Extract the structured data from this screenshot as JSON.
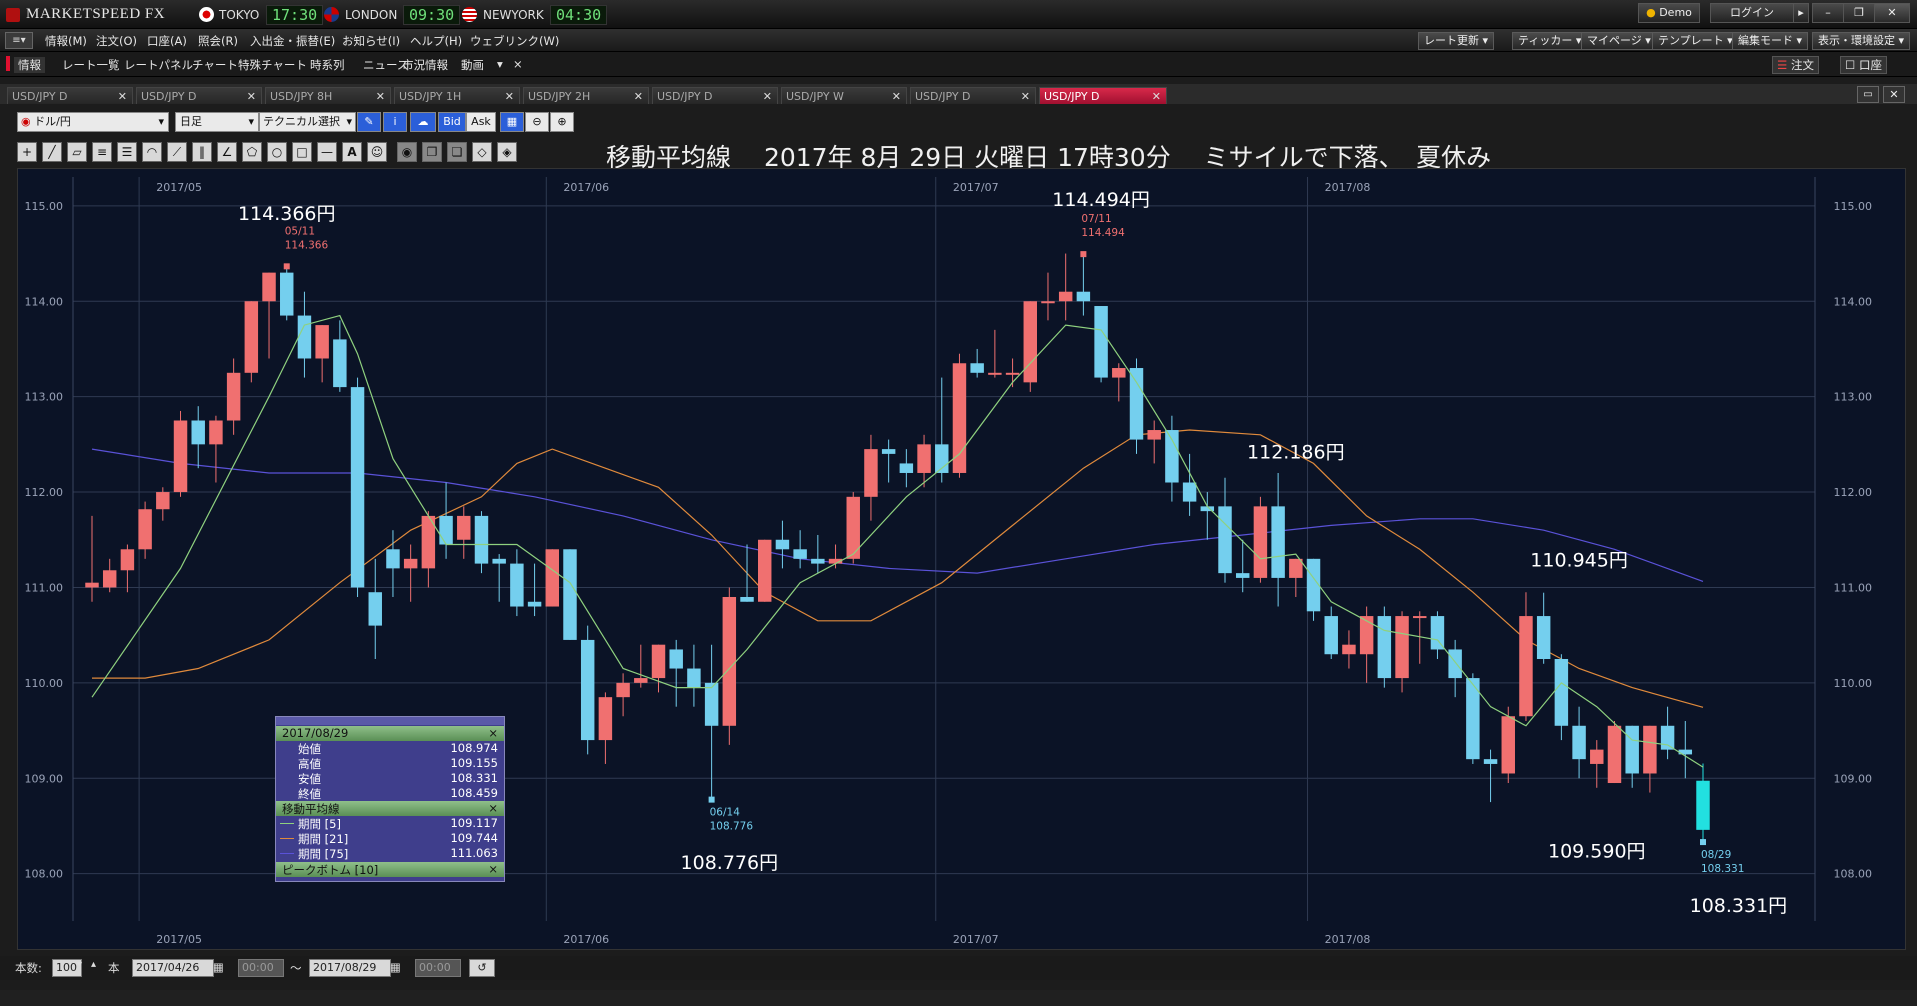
{
  "app": {
    "title": "MARKETSPEED FX",
    "clocks": [
      {
        "city": "TOKYO",
        "time": "17:30"
      },
      {
        "city": "LONDON",
        "time": "09:30"
      },
      {
        "city": "NEWYORK",
        "time": "04:30"
      }
    ],
    "demo_label": "Demo",
    "login_label": "ログイン",
    "window_controls": [
      "minimize",
      "restore",
      "close"
    ]
  },
  "menu": {
    "items": [
      "情報(M)",
      "注文(O)",
      "口座(A)",
      "照会(R)",
      "入出金・振替(E)",
      "お知らせ(I)",
      "ヘルプ(H)",
      "ウェブリンク(W)"
    ],
    "right_buttons": [
      "レート更新",
      "ティッカー",
      "マイページ",
      "テンプレート",
      "編集モード",
      "表示・環境設定"
    ]
  },
  "subtoolbar": {
    "info_label": "情報",
    "items": [
      "レート一覧",
      "レートパネル",
      "チャート",
      "特殊チャート",
      "時系列",
      "ニュース",
      "市況情報",
      "動画"
    ],
    "order_label": "注文",
    "account_label": "口座"
  },
  "tabs": [
    "USD/JPY D",
    "USD/JPY D",
    "USD/JPY 8H",
    "USD/JPY 1H",
    "USD/JPY 2H",
    "USD/JPY D",
    "USD/JPY W",
    "USD/JPY D",
    "USD/JPY D"
  ],
  "active_tab": 8,
  "chart_controls": {
    "pair": "ドル/円",
    "period": "日足",
    "technical": "テクニカル選択",
    "bid": "Bid",
    "ask": "Ask"
  },
  "chart_title": "移動平均線　 2017年 8月 29日 火曜日 17時30分　 ミサイルで下落、　夏休み",
  "status": {
    "count_label": "本数:",
    "count_value": "100",
    "count_unit": "本",
    "from_date": "2017/04/26",
    "from_time": "00:00",
    "tilde": "〜",
    "to_date": "2017/08/29",
    "to_time": "00:00"
  },
  "infobox": {
    "date": "2017/08/29",
    "ohlc": [
      {
        "label": "始値",
        "value": "108.974"
      },
      {
        "label": "高値",
        "value": "109.155"
      },
      {
        "label": "安値",
        "value": "108.331"
      },
      {
        "label": "終値",
        "value": "108.459"
      }
    ],
    "ma_header": "移動平均線",
    "ma": [
      {
        "label": "期間 [5]",
        "value": "109.117",
        "color": "#8fd17f"
      },
      {
        "label": "期間 [21]",
        "value": "109.744",
        "color": "#e08a3c"
      },
      {
        "label": "期間 [75]",
        "value": "111.063",
        "color": "#5a52d8"
      }
    ],
    "peak_header": "ピークボトム [10]"
  },
  "chart_data": {
    "type": "candlestick",
    "ylim": [
      107.65,
      115.25
    ],
    "yticks": [
      "115.00",
      "114.00",
      "113.00",
      "112.00",
      "111.00",
      "110.00",
      "109.00",
      "108.00"
    ],
    "month_labels": [
      {
        "label": "2017/05",
        "index": 3
      },
      {
        "label": "2017/06",
        "index": 26
      },
      {
        "label": "2017/07",
        "index": 48
      },
      {
        "label": "2017/08",
        "index": 69
      }
    ],
    "colors": {
      "up": "#f07070",
      "down": "#74cfee",
      "ma5": "#8fd17f",
      "ma21": "#e08a3c",
      "ma75": "#5a52d8",
      "grid": "#2f3a52"
    },
    "candles": [
      [
        111.0,
        111.75,
        110.85,
        111.05
      ],
      [
        111.0,
        111.3,
        110.95,
        111.18
      ],
      [
        111.18,
        111.45,
        110.95,
        111.4
      ],
      [
        111.4,
        111.9,
        111.3,
        111.82
      ],
      [
        111.82,
        112.05,
        111.7,
        112.0
      ],
      [
        112.0,
        112.85,
        111.95,
        112.75
      ],
      [
        112.75,
        112.9,
        112.25,
        112.5
      ],
      [
        112.5,
        112.8,
        112.1,
        112.75
      ],
      [
        112.75,
        113.4,
        112.6,
        113.25
      ],
      [
        113.25,
        114.0,
        113.15,
        114.0
      ],
      [
        114.0,
        114.3,
        113.4,
        114.3
      ],
      [
        114.3,
        114.366,
        113.8,
        113.85
      ],
      [
        113.85,
        114.1,
        113.2,
        113.4
      ],
      [
        113.4,
        113.75,
        113.15,
        113.75
      ],
      [
        113.6,
        113.8,
        113.05,
        113.1
      ],
      [
        113.1,
        113.2,
        110.9,
        111.0
      ],
      [
        110.95,
        111.3,
        110.25,
        110.6
      ],
      [
        111.4,
        111.6,
        110.9,
        111.2
      ],
      [
        111.2,
        111.45,
        110.85,
        111.3
      ],
      [
        111.2,
        111.8,
        111.0,
        111.75
      ],
      [
        111.75,
        112.1,
        111.3,
        111.45
      ],
      [
        111.5,
        111.85,
        111.3,
        111.75
      ],
      [
        111.75,
        111.8,
        111.15,
        111.25
      ],
      [
        111.3,
        111.35,
        110.85,
        111.25
      ],
      [
        111.25,
        111.4,
        110.7,
        110.8
      ],
      [
        110.85,
        111.25,
        110.7,
        110.8
      ],
      [
        110.8,
        111.4,
        110.8,
        111.4
      ],
      [
        111.4,
        111.4,
        110.45,
        110.45
      ],
      [
        110.45,
        110.6,
        109.25,
        109.4
      ],
      [
        109.4,
        109.9,
        109.15,
        109.85
      ],
      [
        109.85,
        110.1,
        109.65,
        110.0
      ],
      [
        110.0,
        110.4,
        109.95,
        110.05
      ],
      [
        110.05,
        110.4,
        109.9,
        110.4
      ],
      [
        110.35,
        110.45,
        109.75,
        110.15
      ],
      [
        110.15,
        110.4,
        109.75,
        109.95
      ],
      [
        110.0,
        110.4,
        108.776,
        109.55
      ],
      [
        109.55,
        111.0,
        109.35,
        110.9
      ],
      [
        110.9,
        111.45,
        110.85,
        110.85
      ],
      [
        110.85,
        111.5,
        110.85,
        111.5
      ],
      [
        111.5,
        111.7,
        111.2,
        111.4
      ],
      [
        111.4,
        111.6,
        111.2,
        111.3
      ],
      [
        111.3,
        111.55,
        111.15,
        111.25
      ],
      [
        111.25,
        111.45,
        111.2,
        111.3
      ],
      [
        111.3,
        112.0,
        111.25,
        111.95
      ],
      [
        111.95,
        112.6,
        111.7,
        112.45
      ],
      [
        112.45,
        112.55,
        112.1,
        112.4
      ],
      [
        112.3,
        112.45,
        112.05,
        112.2
      ],
      [
        112.2,
        112.6,
        112.05,
        112.5
      ],
      [
        112.5,
        113.2,
        112.1,
        112.2
      ],
      [
        112.2,
        113.45,
        112.15,
        113.35
      ],
      [
        113.35,
        113.5,
        113.2,
        113.25
      ],
      [
        113.25,
        113.7,
        113.2,
        113.25
      ],
      [
        113.25,
        113.4,
        113.1,
        113.25
      ],
      [
        113.15,
        114.0,
        113.05,
        114.0
      ],
      [
        114.0,
        114.3,
        113.8,
        114.0
      ],
      [
        114.0,
        114.5,
        113.8,
        114.1
      ],
      [
        114.1,
        114.494,
        113.85,
        114.0
      ],
      [
        113.95,
        113.95,
        113.15,
        113.2
      ],
      [
        113.2,
        113.35,
        112.95,
        113.3
      ],
      [
        113.3,
        113.4,
        112.4,
        112.55
      ],
      [
        112.55,
        112.75,
        112.3,
        112.65
      ],
      [
        112.65,
        112.8,
        111.9,
        112.1
      ],
      [
        112.1,
        112.4,
        111.75,
        111.9
      ],
      [
        111.85,
        112.0,
        111.5,
        111.8
      ],
      [
        111.85,
        112.15,
        111.05,
        111.15
      ],
      [
        111.15,
        111.5,
        110.95,
        111.1
      ],
      [
        111.1,
        111.95,
        111.05,
        111.85
      ],
      [
        111.85,
        112.2,
        110.8,
        111.1
      ],
      [
        111.1,
        111.3,
        110.9,
        111.3
      ],
      [
        111.3,
        111.3,
        110.65,
        110.75
      ],
      [
        110.7,
        110.8,
        110.25,
        110.3
      ],
      [
        110.3,
        110.55,
        110.15,
        110.4
      ],
      [
        110.3,
        110.8,
        110.0,
        110.7
      ],
      [
        110.7,
        110.8,
        109.95,
        110.05
      ],
      [
        110.05,
        110.75,
        109.9,
        110.7
      ],
      [
        110.7,
        110.75,
        110.2,
        110.7
      ],
      [
        110.7,
        110.75,
        110.25,
        110.35
      ],
      [
        110.35,
        110.45,
        109.85,
        110.05
      ],
      [
        110.05,
        110.1,
        109.15,
        109.2
      ],
      [
        109.2,
        109.3,
        108.75,
        109.15
      ],
      [
        109.05,
        109.75,
        108.95,
        109.65
      ],
      [
        109.65,
        110.95,
        109.6,
        110.7
      ],
      [
        110.7,
        110.945,
        110.2,
        110.25
      ],
      [
        110.25,
        110.3,
        109.4,
        109.55
      ],
      [
        109.55,
        109.75,
        109.0,
        109.2
      ],
      [
        109.15,
        109.4,
        108.9,
        109.3
      ],
      [
        108.95,
        109.6,
        108.95,
        109.55
      ],
      [
        109.55,
        109.55,
        108.9,
        109.05
      ],
      [
        109.05,
        109.55,
        108.85,
        109.55
      ],
      [
        109.55,
        109.75,
        109.2,
        109.3
      ],
      [
        109.3,
        109.6,
        109.0,
        109.25
      ],
      [
        108.974,
        109.155,
        108.331,
        108.459
      ]
    ],
    "ma5": [
      [
        0,
        109.85
      ],
      [
        5,
        111.2
      ],
      [
        10,
        113.0
      ],
      [
        12,
        113.75
      ],
      [
        14,
        113.85
      ],
      [
        15,
        113.45
      ],
      [
        17,
        112.35
      ],
      [
        20,
        111.45
      ],
      [
        24,
        111.45
      ],
      [
        27,
        111.05
      ],
      [
        30,
        110.15
      ],
      [
        33,
        109.95
      ],
      [
        35,
        109.95
      ],
      [
        37,
        110.35
      ],
      [
        40,
        111.05
      ],
      [
        43,
        111.35
      ],
      [
        46,
        111.95
      ],
      [
        49,
        112.4
      ],
      [
        52,
        113.15
      ],
      [
        55,
        113.75
      ],
      [
        57,
        113.7
      ],
      [
        59,
        113.15
      ],
      [
        61,
        112.55
      ],
      [
        63,
        111.85
      ],
      [
        66,
        111.3
      ],
      [
        68,
        111.35
      ],
      [
        70,
        110.85
      ],
      [
        73,
        110.55
      ],
      [
        76,
        110.45
      ],
      [
        79,
        109.75
      ],
      [
        81,
        109.55
      ],
      [
        83,
        110.0
      ],
      [
        85,
        109.75
      ],
      [
        87,
        109.4
      ],
      [
        89,
        109.35
      ],
      [
        91,
        109.117
      ]
    ],
    "ma21": [
      [
        0,
        110.05
      ],
      [
        3,
        110.05
      ],
      [
        6,
        110.15
      ],
      [
        10,
        110.45
      ],
      [
        14,
        111.05
      ],
      [
        18,
        111.6
      ],
      [
        22,
        111.95
      ],
      [
        24,
        112.3
      ],
      [
        26,
        112.45
      ],
      [
        29,
        112.25
      ],
      [
        32,
        112.05
      ],
      [
        35,
        111.55
      ],
      [
        38,
        110.95
      ],
      [
        41,
        110.65
      ],
      [
        44,
        110.65
      ],
      [
        48,
        111.05
      ],
      [
        52,
        111.65
      ],
      [
        56,
        112.25
      ],
      [
        59,
        112.6
      ],
      [
        62,
        112.65
      ],
      [
        66,
        112.6
      ],
      [
        69,
        112.3
      ],
      [
        72,
        111.75
      ],
      [
        75,
        111.4
      ],
      [
        78,
        110.95
      ],
      [
        81,
        110.45
      ],
      [
        84,
        110.15
      ],
      [
        87,
        109.95
      ],
      [
        91,
        109.744
      ]
    ],
    "ma75": [
      [
        0,
        112.45
      ],
      [
        5,
        112.3
      ],
      [
        10,
        112.2
      ],
      [
        15,
        112.2
      ],
      [
        20,
        112.1
      ],
      [
        25,
        111.95
      ],
      [
        30,
        111.75
      ],
      [
        35,
        111.5
      ],
      [
        40,
        111.3
      ],
      [
        45,
        111.2
      ],
      [
        50,
        111.15
      ],
      [
        55,
        111.3
      ],
      [
        60,
        111.45
      ],
      [
        65,
        111.55
      ],
      [
        70,
        111.65
      ],
      [
        75,
        111.72
      ],
      [
        78,
        111.72
      ],
      [
        82,
        111.6
      ],
      [
        86,
        111.4
      ],
      [
        91,
        111.063
      ]
    ],
    "annotations": [
      {
        "text": "114.366円",
        "x": 11,
        "y": 114.85
      },
      {
        "text": "114.494円",
        "x": 57,
        "y": 115.0
      },
      {
        "text": "112.186円",
        "x": 68,
        "y": 112.35
      },
      {
        "text": "110.945円",
        "x": 84,
        "y": 111.22
      },
      {
        "text": "108.776円",
        "x": 36,
        "y": 108.05
      },
      {
        "text": "109.590円",
        "x": 85,
        "y": 108.17
      },
      {
        "text": "108.331円",
        "x": 93,
        "y": 107.6
      }
    ],
    "markers": [
      {
        "date": "05/11",
        "value": "114.366",
        "x": 11,
        "y": 114.366,
        "pos": "high"
      },
      {
        "date": "07/11",
        "value": "114.494",
        "x": 56,
        "y": 114.494,
        "pos": "high"
      },
      {
        "date": "06/14",
        "value": "108.776",
        "x": 35,
        "y": 108.776,
        "pos": "low"
      },
      {
        "date": "08/29",
        "value": "108.331",
        "x": 91,
        "y": 108.331,
        "pos": "low"
      }
    ]
  }
}
